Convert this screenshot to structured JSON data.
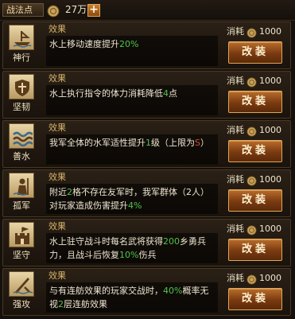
{
  "header": {
    "label": "战法点",
    "amount": "27万",
    "plus": "+"
  },
  "colors": {
    "accent": "#d9b46a",
    "highlight": "#4fc34a",
    "warning": "#e0453a",
    "button": "#7a3a10"
  },
  "skills": [
    {
      "name": "神行",
      "icon": "ship-icon",
      "effect_title": "效果",
      "desc": [
        {
          "t": "水上移动速度提升"
        },
        {
          "t": "20%",
          "c": "hl"
        }
      ],
      "cost_label": "消耗",
      "cost": "1000",
      "button": "改装"
    },
    {
      "name": "坚韧",
      "icon": "shield-icon",
      "effect_title": "效果",
      "desc": [
        {
          "t": "水上执行指令的体力消耗降低"
        },
        {
          "t": "4",
          "c": "hl"
        },
        {
          "t": "点"
        }
      ],
      "cost_label": "消耗",
      "cost": "1000",
      "button": "改装"
    },
    {
      "name": "善水",
      "icon": "wave-icon",
      "effect_title": "效果",
      "desc": [
        {
          "t": "我军全体的水军适性提升"
        },
        {
          "t": "1",
          "c": "hl"
        },
        {
          "t": "级（上限为"
        },
        {
          "t": "S",
          "c": "red"
        },
        {
          "t": "）"
        }
      ],
      "cost_label": "消耗",
      "cost": "1000",
      "button": "改装"
    },
    {
      "name": "孤军",
      "icon": "soldier-icon",
      "effect_title": "效果",
      "desc": [
        {
          "t": "附近"
        },
        {
          "t": "2",
          "c": "hl"
        },
        {
          "t": "格不存在友军时，我军群体（2人）对玩家造成伤害提升"
        },
        {
          "t": "4%",
          "c": "hl"
        }
      ],
      "cost_label": "消耗",
      "cost": "1000",
      "button": "改装"
    },
    {
      "name": "坚守",
      "icon": "fortress-icon",
      "effect_title": "效果",
      "desc": [
        {
          "t": "水上驻守战斗时每名武将获得"
        },
        {
          "t": "200",
          "c": "hl"
        },
        {
          "t": "乡勇兵力，且战斗后恢复"
        },
        {
          "t": "10%",
          "c": "hl"
        },
        {
          "t": "伤兵"
        }
      ],
      "cost_label": "消耗",
      "cost": "1000",
      "button": "改装"
    },
    {
      "name": "强攻",
      "icon": "attack-icon",
      "effect_title": "效果",
      "desc": [
        {
          "t": "与有连舫效果的玩家交战时，"
        },
        {
          "t": "40%",
          "c": "hl"
        },
        {
          "t": "概率无视"
        },
        {
          "t": "2",
          "c": "hl"
        },
        {
          "t": "层连舫效果"
        }
      ],
      "cost_label": "消耗",
      "cost": "1000",
      "button": "改装"
    }
  ]
}
